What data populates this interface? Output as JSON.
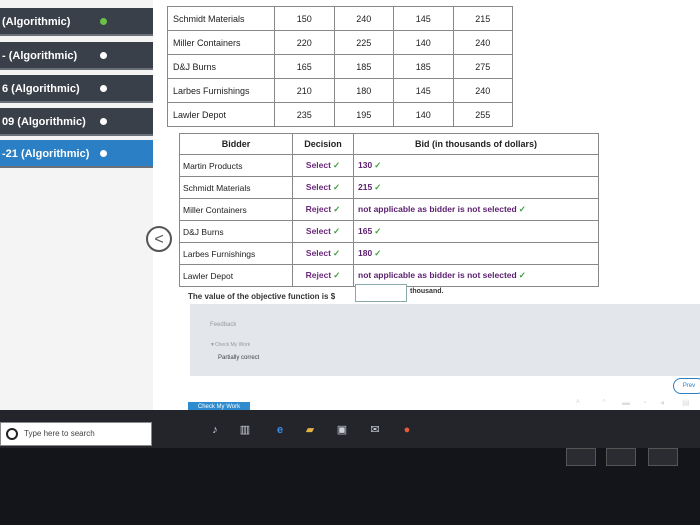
{
  "sidebar": {
    "items": [
      {
        "label": "(Algorithmic)",
        "dot": "green",
        "active": false
      },
      {
        "label": "- (Algorithmic)",
        "dot": "white",
        "active": false
      },
      {
        "label": "6 (Algorithmic)",
        "dot": "white",
        "active": false
      },
      {
        "label": "09 (Algorithmic)",
        "dot": "white",
        "active": false
      },
      {
        "label": "-21 (Algorithmic)",
        "dot": "white",
        "active": true
      }
    ]
  },
  "bids_table": {
    "rows": [
      {
        "name": "Schmidt Materials",
        "values": [
          "150",
          "240",
          "145",
          "215"
        ]
      },
      {
        "name": "Miller Containers",
        "values": [
          "220",
          "225",
          "140",
          "240"
        ]
      },
      {
        "name": "D&J Burns",
        "values": [
          "165",
          "185",
          "185",
          "275"
        ]
      },
      {
        "name": "Larbes Furnishings",
        "values": [
          "210",
          "180",
          "145",
          "240"
        ]
      },
      {
        "name": "Lawler Depot",
        "values": [
          "235",
          "195",
          "140",
          "255"
        ]
      }
    ]
  },
  "decision_table": {
    "headers": {
      "bidder": "Bidder",
      "decision": "Decision",
      "bid": "Bid (in thousands of dollars)"
    },
    "rows": [
      {
        "bidder": "Martin Products",
        "decision": "Select",
        "bid": "130"
      },
      {
        "bidder": "Schmidt Materials",
        "decision": "Select",
        "bid": "215"
      },
      {
        "bidder": "Miller Containers",
        "decision": "Reject",
        "bid": "not applicable as bidder is not selected"
      },
      {
        "bidder": "D&J Burns",
        "decision": "Select",
        "bid": "165"
      },
      {
        "bidder": "Larbes Furnishings",
        "decision": "Select",
        "bid": "180"
      },
      {
        "bidder": "Lawler Depot",
        "decision": "Reject",
        "bid": "not applicable as bidder is not selected"
      }
    ],
    "check_mark": "✓"
  },
  "objective": {
    "label": "The value of the objective function is $",
    "value": "",
    "unit": "thousand."
  },
  "feedback": {
    "title": "Feedback",
    "check_label": "▼Check My Work",
    "result": "Partially correct"
  },
  "buttons": {
    "check_work": "Check My Work",
    "previous": "Prev",
    "prev_arrow": "<"
  },
  "taskbar": {
    "search_placeholder": "Type here to search"
  },
  "colors": {
    "sidebar_item": "#3a4049",
    "sidebar_active": "#2b7fc4",
    "check": "#3a9d3a",
    "decision_text": "#6a2a7a",
    "taskbar": "#23252b"
  }
}
